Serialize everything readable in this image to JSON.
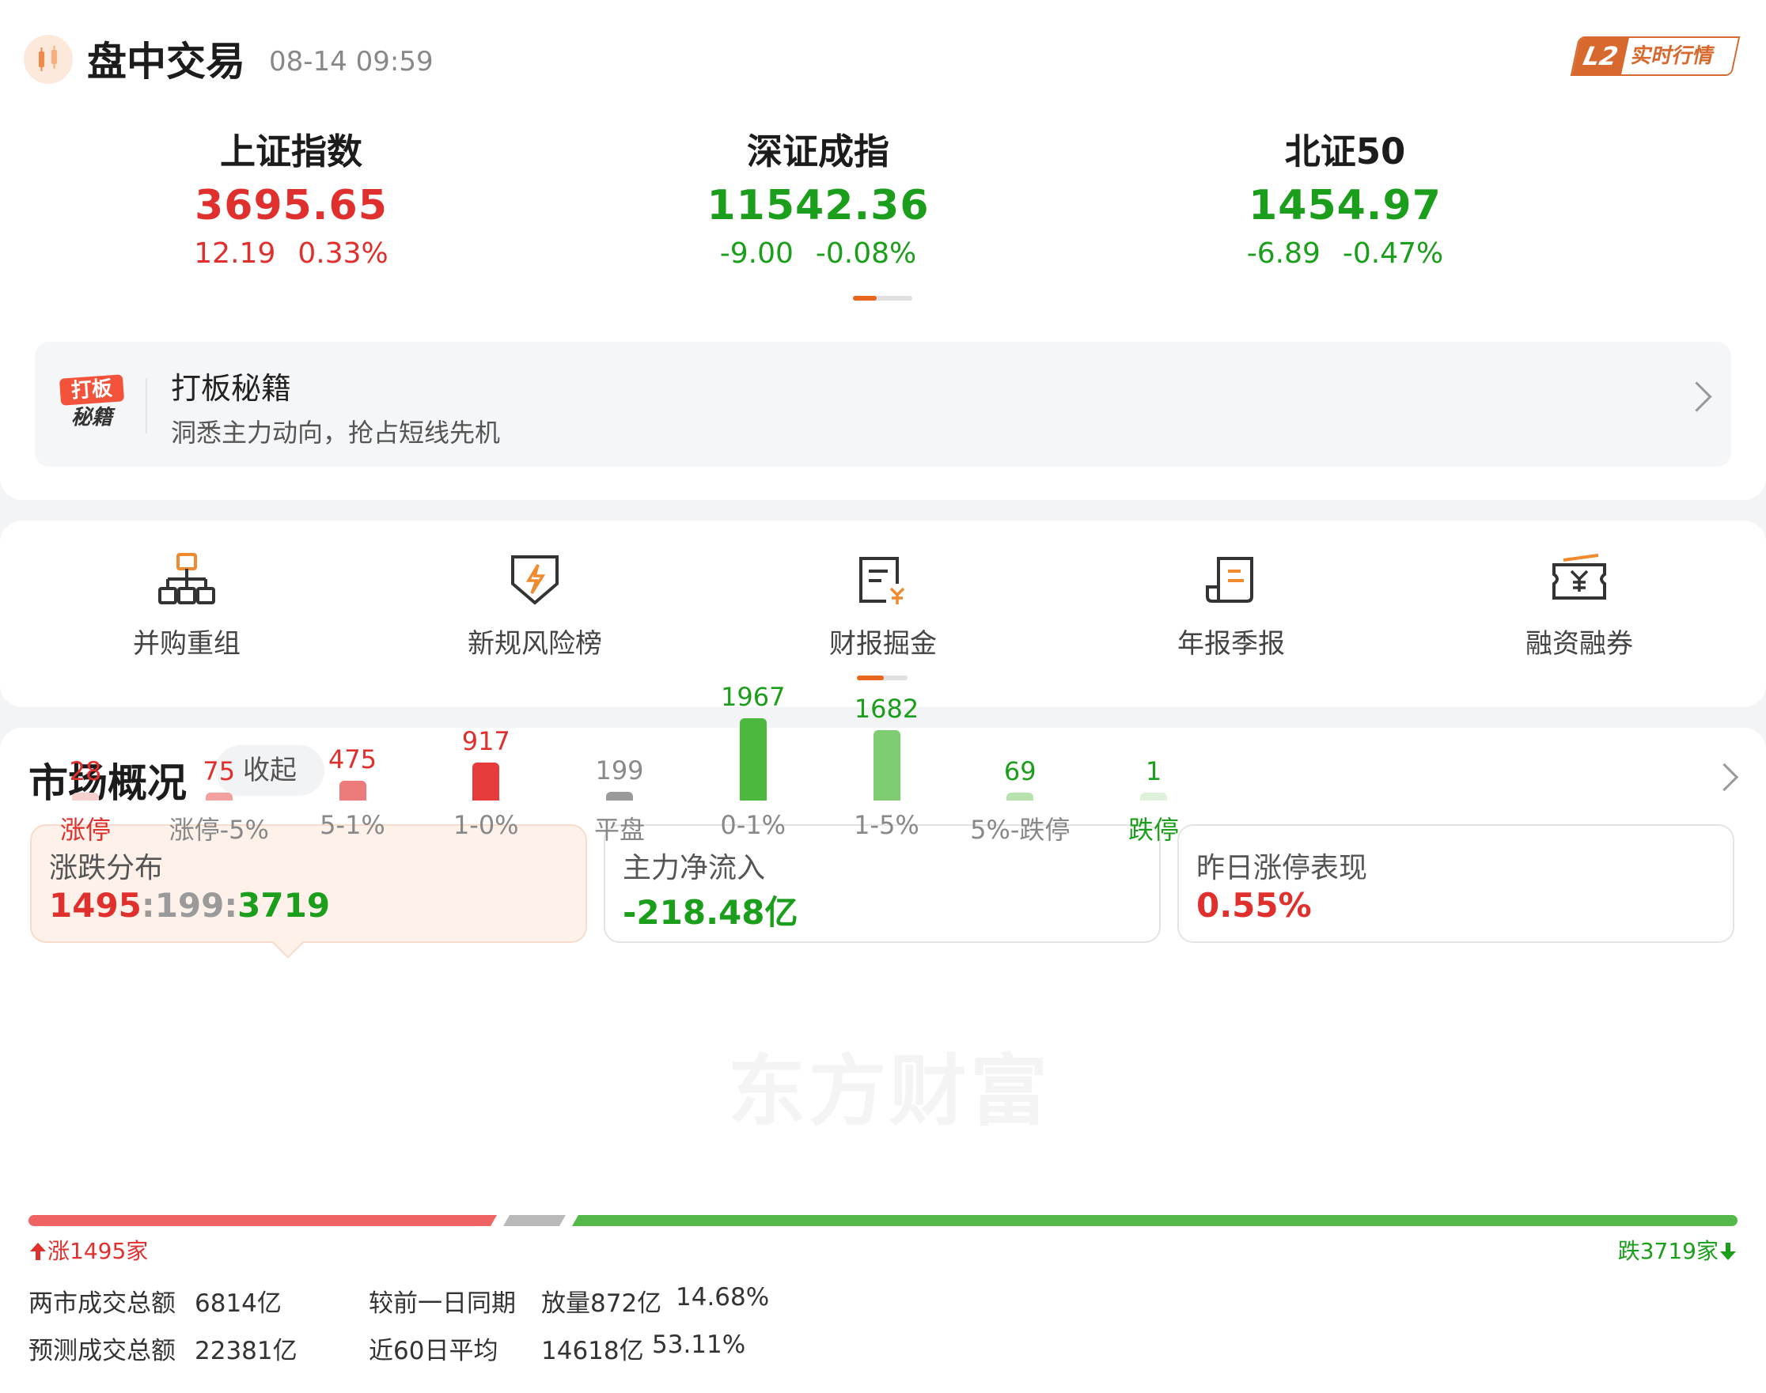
{
  "header": {
    "title": "盘中交易",
    "time": "08-14 09:59",
    "badge_l2": "L2",
    "badge_text": "实时行情"
  },
  "indices": [
    {
      "name": "上证指数",
      "value": "3695.65",
      "change": "12.19",
      "pct": "0.33%",
      "direction": "up"
    },
    {
      "name": "深证成指",
      "value": "11542.36",
      "change": "-9.00",
      "pct": "-0.08%",
      "direction": "down"
    },
    {
      "name": "北证50",
      "value": "1454.97",
      "change": "-6.89",
      "pct": "-0.47%",
      "direction": "down"
    }
  ],
  "promo": {
    "logo_line1": "打板",
    "logo_line2": "秘籍",
    "title": "打板秘籍",
    "subtitle": "洞悉主力动向，抢占短线先机"
  },
  "shortcuts": [
    {
      "label": "并购重组",
      "icon": "org-chart-icon"
    },
    {
      "label": "新规风险榜",
      "icon": "shield-lightning-icon"
    },
    {
      "label": "财报掘金",
      "icon": "report-yuan-icon"
    },
    {
      "label": "年报季报",
      "icon": "scroll-doc-icon"
    },
    {
      "label": "融资融券",
      "icon": "ticket-yuan-icon"
    }
  ],
  "market": {
    "title": "市场概况",
    "collapse_label": "收起",
    "tiles": [
      {
        "label": "涨跌分布",
        "up": "1495",
        "sep": ":",
        "flat": "199",
        "down": "3719"
      },
      {
        "label": "主力净流入",
        "value": "-218.48亿"
      },
      {
        "label": "昨日涨停表现",
        "value": "0.55%"
      }
    ],
    "watermark": "东方财富",
    "up_note": "涨1495家",
    "down_note": "跌3719家",
    "ratio": {
      "up": 1495,
      "flat": 199,
      "down": 3719
    },
    "stats": {
      "row1_label": "两市成交总额",
      "row1_value": "6814亿",
      "row1_cmp_label": "较前一日同期",
      "row1_cmp_value": "放量872亿",
      "row1_cmp_pct": "14.68%",
      "row2_label": "预测成交总额",
      "row2_value": "22381亿",
      "row2_cmp_label": "近60日平均",
      "row2_cmp_value": "14618亿",
      "row2_cmp_pct": "53.11%"
    }
  },
  "chart_data": {
    "type": "bar",
    "categories": [
      "涨停",
      "涨停-5%",
      "5-1%",
      "1-0%",
      "平盘",
      "0-1%",
      "1-5%",
      "5%-跌停",
      "跌停"
    ],
    "values": [
      28,
      75,
      475,
      917,
      199,
      1967,
      1682,
      69,
      1
    ],
    "colors": [
      "#f6cfcf",
      "#f2a0a0",
      "#ee7b7b",
      "#e53b3b",
      "#9a9a9a",
      "#4cb83d",
      "#7fcc72",
      "#b7e2ae",
      "#dff1da"
    ],
    "label_colors": [
      "#e0302e",
      "#e0302e",
      "#e0302e",
      "#e0302e",
      "#8a8a8a",
      "#1b9e1b",
      "#1b9e1b",
      "#1b9e1b",
      "#1b9e1b"
    ],
    "category_colors": [
      "#e0302e",
      "#888888",
      "#888888",
      "#888888",
      "#888888",
      "#888888",
      "#888888",
      "#888888",
      "#1b9e1b"
    ]
  }
}
